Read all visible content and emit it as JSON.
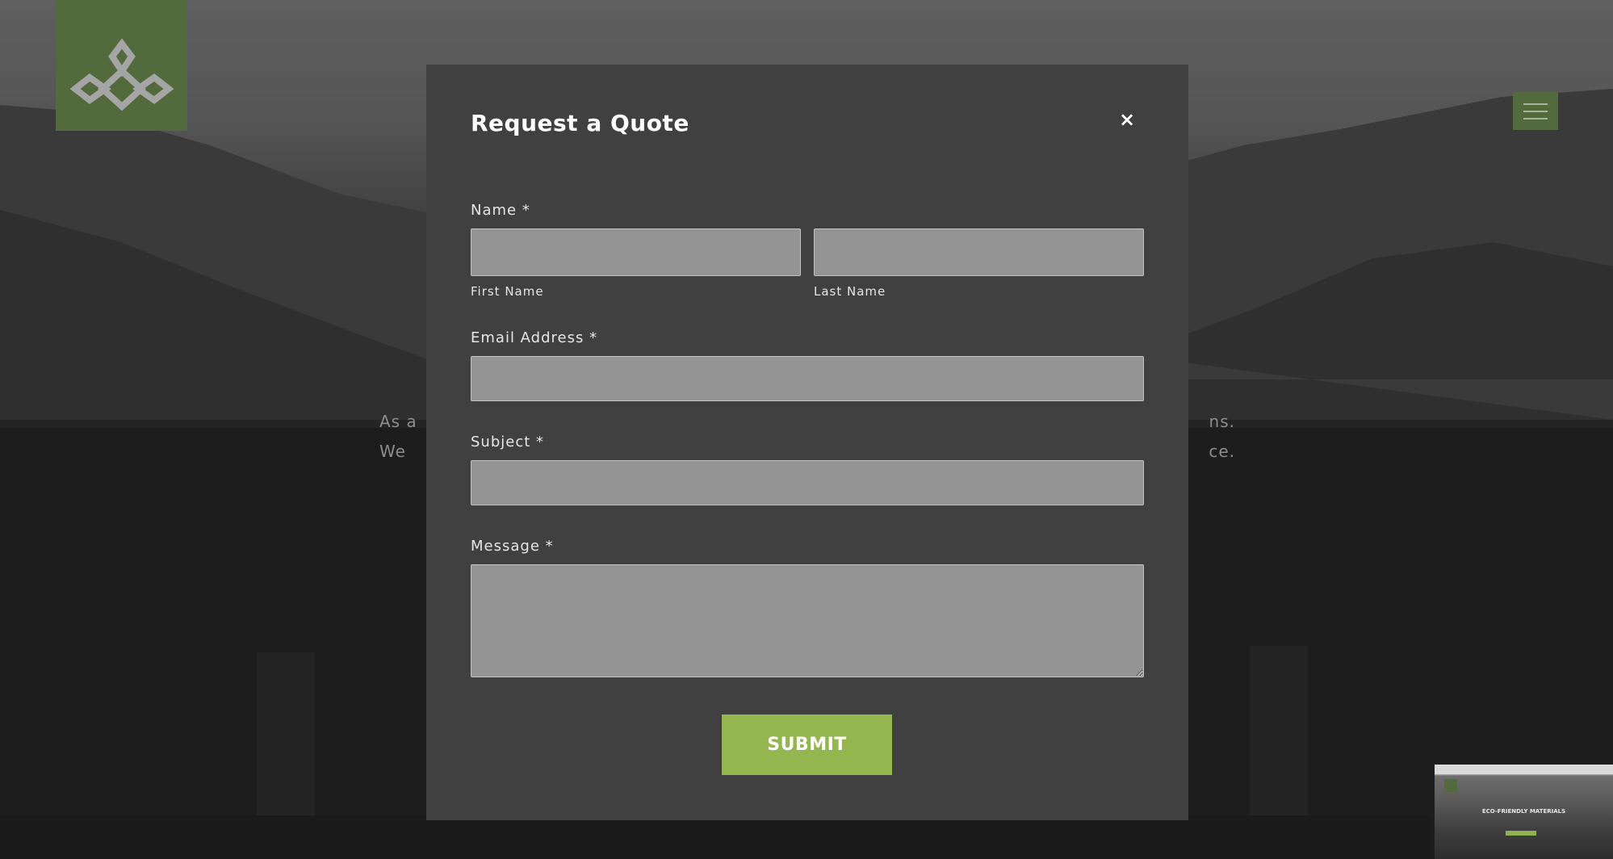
{
  "hero": {
    "line1_start": "As a",
    "line1_end": "ns.",
    "line2_start": "We",
    "line2_end": "ce."
  },
  "modal": {
    "title": "Request a Quote",
    "close_glyph": "×",
    "name_label": "Name *",
    "first_name_sublabel": "First Name",
    "last_name_sublabel": "Last Name",
    "first_name_value": "",
    "last_name_value": "",
    "email_label": "Email Address *",
    "email_value": "",
    "subject_label": "Subject *",
    "subject_value": "",
    "message_label": "Message *",
    "message_value": "",
    "submit_label": "SUBMIT"
  },
  "thumbnail": {
    "title": "ECO-FRIENDLY MATERIALS"
  },
  "icons": {
    "logo": "leaf-logo-icon",
    "menu": "hamburger-menu-icon",
    "close": "close-icon"
  },
  "colors": {
    "brand_green": "#536b3c",
    "submit_green": "#95b54f",
    "modal_bg": "#404040",
    "field_bg": "#949494"
  }
}
